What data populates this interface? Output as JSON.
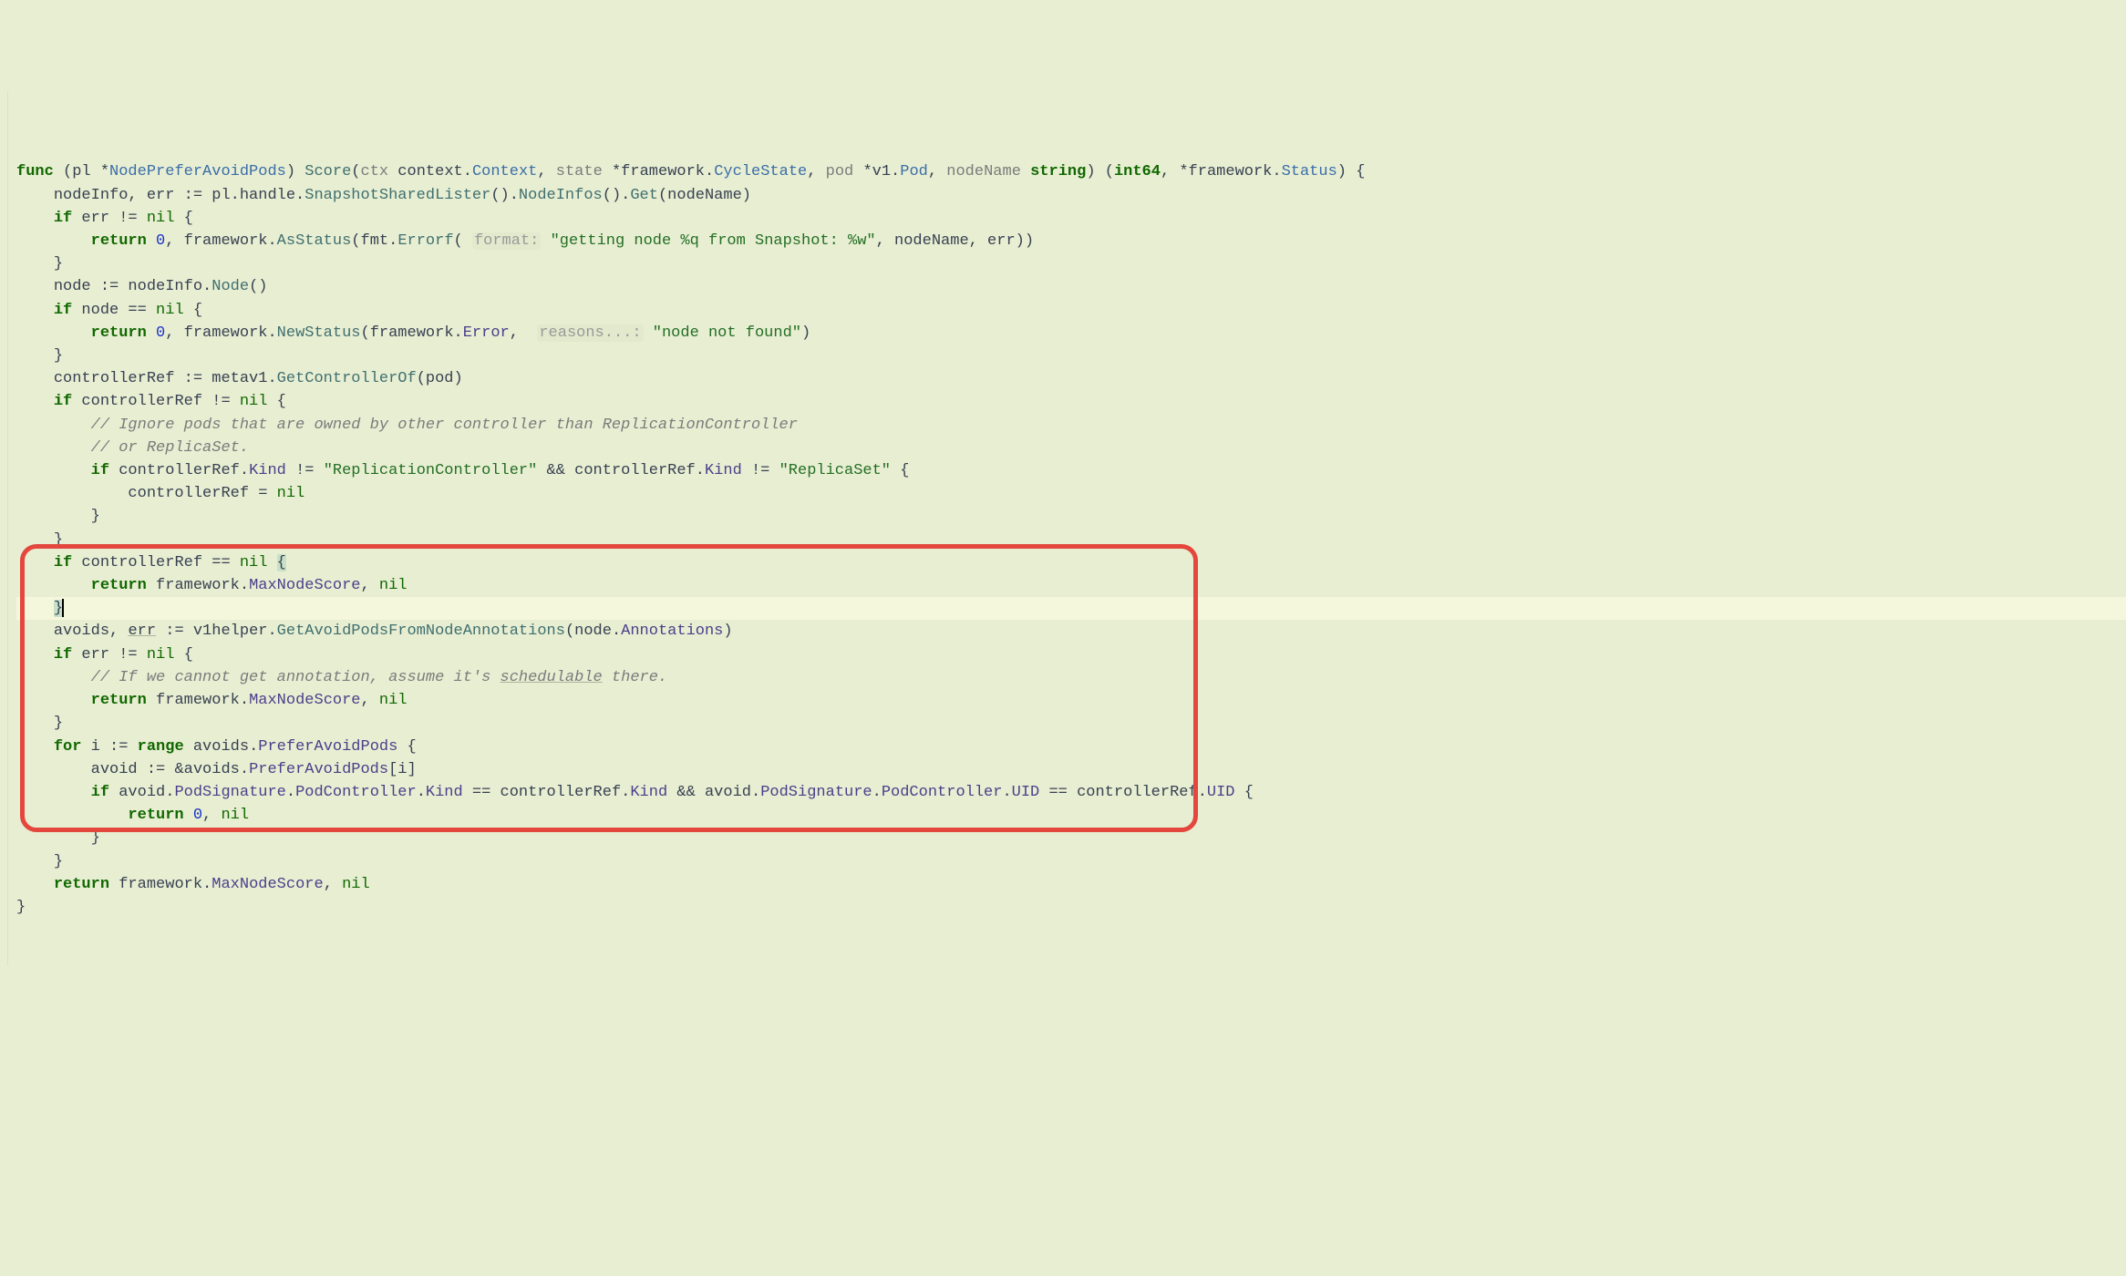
{
  "lang": "go",
  "colors": {
    "bg": "#e8eed2",
    "highlight_line": "#f5f7dc",
    "box": "#e4473d"
  },
  "lines": [
    {
      "n": 1,
      "tokens": [
        {
          "t": "func ",
          "c": "kw"
        },
        {
          "t": "(pl *",
          "c": "op"
        },
        {
          "t": "NodePreferAvoidPods",
          "c": "type"
        },
        {
          "t": ") ",
          "c": "op"
        },
        {
          "t": "Score",
          "c": "fn"
        },
        {
          "t": "(",
          "c": "op"
        },
        {
          "t": "ctx",
          "c": "param"
        },
        {
          "t": " context.",
          "c": "id"
        },
        {
          "t": "Context",
          "c": "type"
        },
        {
          "t": ", ",
          "c": "op"
        },
        {
          "t": "state",
          "c": "param"
        },
        {
          "t": " *framework.",
          "c": "id"
        },
        {
          "t": "CycleState",
          "c": "type"
        },
        {
          "t": ", ",
          "c": "op"
        },
        {
          "t": "pod",
          "c": "param"
        },
        {
          "t": " *v1.",
          "c": "id"
        },
        {
          "t": "Pod",
          "c": "type"
        },
        {
          "t": ", ",
          "c": "op"
        },
        {
          "t": "nodeName",
          "c": "param"
        },
        {
          "t": " ",
          "c": "op"
        },
        {
          "t": "string",
          "c": "kw"
        },
        {
          "t": ") (",
          "c": "op"
        },
        {
          "t": "int64",
          "c": "kw"
        },
        {
          "t": ", *framework.",
          "c": "id"
        },
        {
          "t": "Status",
          "c": "type"
        },
        {
          "t": ") {",
          "c": "op"
        }
      ]
    },
    {
      "n": 2,
      "indent": 1,
      "tokens": [
        {
          "t": "nodeInfo, err := pl.handle.",
          "c": "id"
        },
        {
          "t": "SnapshotSharedLister",
          "c": "fn"
        },
        {
          "t": "().",
          "c": "op"
        },
        {
          "t": "NodeInfos",
          "c": "fn"
        },
        {
          "t": "().",
          "c": "op"
        },
        {
          "t": "Get",
          "c": "fn"
        },
        {
          "t": "(nodeName)",
          "c": "op"
        }
      ]
    },
    {
      "n": 3,
      "indent": 1,
      "tokens": [
        {
          "t": "if ",
          "c": "kw"
        },
        {
          "t": "err != ",
          "c": "id"
        },
        {
          "t": "nil ",
          "c": "nil"
        },
        {
          "t": "{",
          "c": "op"
        }
      ]
    },
    {
      "n": 4,
      "indent": 2,
      "tokens": [
        {
          "t": "return ",
          "c": "kw"
        },
        {
          "t": "0",
          "c": "num"
        },
        {
          "t": ", framework.",
          "c": "id"
        },
        {
          "t": "AsStatus",
          "c": "fn"
        },
        {
          "t": "(fmt.",
          "c": "id"
        },
        {
          "t": "Errorf",
          "c": "fn"
        },
        {
          "t": "( ",
          "c": "op"
        },
        {
          "t": "format:",
          "c": "hint"
        },
        {
          "t": " ",
          "c": "op"
        },
        {
          "t": "\"getting node %q from Snapshot: %w\"",
          "c": "str"
        },
        {
          "t": ", nodeName, err))",
          "c": "id"
        }
      ]
    },
    {
      "n": 5,
      "indent": 1,
      "tokens": [
        {
          "t": "}",
          "c": "op"
        }
      ]
    },
    {
      "n": 6,
      "indent": 1,
      "tokens": [
        {
          "t": "node := nodeInfo.",
          "c": "id"
        },
        {
          "t": "Node",
          "c": "fn"
        },
        {
          "t": "()",
          "c": "op"
        }
      ]
    },
    {
      "n": 7,
      "indent": 1,
      "tokens": [
        {
          "t": "if ",
          "c": "kw"
        },
        {
          "t": "node == ",
          "c": "id"
        },
        {
          "t": "nil ",
          "c": "nil"
        },
        {
          "t": "{",
          "c": "op"
        }
      ]
    },
    {
      "n": 8,
      "indent": 2,
      "tokens": [
        {
          "t": "return ",
          "c": "kw"
        },
        {
          "t": "0",
          "c": "num"
        },
        {
          "t": ", framework.",
          "c": "id"
        },
        {
          "t": "NewStatus",
          "c": "fn"
        },
        {
          "t": "(framework.",
          "c": "id"
        },
        {
          "t": "Error",
          "c": "member"
        },
        {
          "t": ",  ",
          "c": "op"
        },
        {
          "t": "reasons...:",
          "c": "hint"
        },
        {
          "t": " ",
          "c": "op"
        },
        {
          "t": "\"node not found\"",
          "c": "str"
        },
        {
          "t": ")",
          "c": "op"
        }
      ]
    },
    {
      "n": 9,
      "indent": 1,
      "tokens": [
        {
          "t": "}",
          "c": "op"
        }
      ]
    },
    {
      "n": 10,
      "indent": 1,
      "tokens": [
        {
          "t": "controllerRef := metav1.",
          "c": "id"
        },
        {
          "t": "GetControllerOf",
          "c": "fn"
        },
        {
          "t": "(pod)",
          "c": "op"
        }
      ]
    },
    {
      "n": 11,
      "indent": 1,
      "tokens": [
        {
          "t": "if ",
          "c": "kw"
        },
        {
          "t": "controllerRef != ",
          "c": "id"
        },
        {
          "t": "nil ",
          "c": "nil"
        },
        {
          "t": "{",
          "c": "op"
        }
      ]
    },
    {
      "n": 12,
      "indent": 2,
      "tokens": [
        {
          "t": "// Ignore pods that are owned by other controller than ReplicationController",
          "c": "comment"
        }
      ]
    },
    {
      "n": 13,
      "indent": 2,
      "tokens": [
        {
          "t": "// or ReplicaSet.",
          "c": "comment"
        }
      ]
    },
    {
      "n": 14,
      "indent": 2,
      "tokens": [
        {
          "t": "if ",
          "c": "kw"
        },
        {
          "t": "controllerRef.",
          "c": "id"
        },
        {
          "t": "Kind",
          "c": "member"
        },
        {
          "t": " != ",
          "c": "op"
        },
        {
          "t": "\"ReplicationController\"",
          "c": "str"
        },
        {
          "t": " && controllerRef.",
          "c": "id"
        },
        {
          "t": "Kind",
          "c": "member"
        },
        {
          "t": " != ",
          "c": "op"
        },
        {
          "t": "\"ReplicaSet\"",
          "c": "str"
        },
        {
          "t": " {",
          "c": "op"
        }
      ]
    },
    {
      "n": 15,
      "indent": 3,
      "tokens": [
        {
          "t": "controllerRef = ",
          "c": "id"
        },
        {
          "t": "nil",
          "c": "nil"
        }
      ]
    },
    {
      "n": 16,
      "indent": 2,
      "tokens": [
        {
          "t": "}",
          "c": "op"
        }
      ]
    },
    {
      "n": 17,
      "indent": 1,
      "tokens": [
        {
          "t": "}",
          "c": "op"
        }
      ]
    },
    {
      "n": 18,
      "indent": 1,
      "tokens": [
        {
          "t": "if ",
          "c": "kw"
        },
        {
          "t": "controllerRef == ",
          "c": "id"
        },
        {
          "t": "nil ",
          "c": "nil"
        },
        {
          "t": "{",
          "c": "op",
          "wrap": "brace-match"
        }
      ]
    },
    {
      "n": 19,
      "indent": 2,
      "tokens": [
        {
          "t": "return ",
          "c": "kw"
        },
        {
          "t": "framework.",
          "c": "id"
        },
        {
          "t": "MaxNodeScore",
          "c": "member"
        },
        {
          "t": ", ",
          "c": "op"
        },
        {
          "t": "nil",
          "c": "nil"
        }
      ]
    },
    {
      "n": 20,
      "indent": 1,
      "hl": true,
      "caret": true,
      "tokens": [
        {
          "t": "}",
          "c": "op",
          "wrap": "brace-match"
        }
      ]
    },
    {
      "n": 21,
      "indent": 1,
      "tokens": [
        {
          "t": "avoids, ",
          "c": "id"
        },
        {
          "t": "err",
          "c": "id underline"
        },
        {
          "t": " := v1helper.",
          "c": "id"
        },
        {
          "t": "GetAvoidPodsFromNodeAnnotations",
          "c": "fn"
        },
        {
          "t": "(node.",
          "c": "id"
        },
        {
          "t": "Annotations",
          "c": "member"
        },
        {
          "t": ")",
          "c": "op"
        }
      ]
    },
    {
      "n": 22,
      "indent": 1,
      "tokens": [
        {
          "t": "if ",
          "c": "kw"
        },
        {
          "t": "err != ",
          "c": "id"
        },
        {
          "t": "nil ",
          "c": "nil"
        },
        {
          "t": "{",
          "c": "op"
        }
      ]
    },
    {
      "n": 23,
      "indent": 2,
      "tokens": [
        {
          "t": "// If we cannot get annotation, assume it's ",
          "c": "comment"
        },
        {
          "t": "schedulable",
          "c": "comment underline"
        },
        {
          "t": " there.",
          "c": "comment"
        }
      ]
    },
    {
      "n": 24,
      "indent": 2,
      "tokens": [
        {
          "t": "return ",
          "c": "kw"
        },
        {
          "t": "framework.",
          "c": "id"
        },
        {
          "t": "MaxNodeScore",
          "c": "member"
        },
        {
          "t": ", ",
          "c": "op"
        },
        {
          "t": "nil",
          "c": "nil"
        }
      ]
    },
    {
      "n": 25,
      "indent": 1,
      "tokens": [
        {
          "t": "}",
          "c": "op"
        }
      ]
    },
    {
      "n": 26,
      "indent": 1,
      "tokens": [
        {
          "t": "for ",
          "c": "kw"
        },
        {
          "t": "i := ",
          "c": "id"
        },
        {
          "t": "range ",
          "c": "kw"
        },
        {
          "t": "avoids.",
          "c": "id"
        },
        {
          "t": "PreferAvoidPods",
          "c": "member"
        },
        {
          "t": " {",
          "c": "op"
        }
      ]
    },
    {
      "n": 27,
      "indent": 2,
      "tokens": [
        {
          "t": "avoid := &avoids.",
          "c": "id"
        },
        {
          "t": "PreferAvoidPods",
          "c": "member"
        },
        {
          "t": "[i]",
          "c": "op"
        }
      ]
    },
    {
      "n": 28,
      "indent": 2,
      "tokens": [
        {
          "t": "if ",
          "c": "kw"
        },
        {
          "t": "avoid.",
          "c": "id"
        },
        {
          "t": "PodSignature",
          "c": "member"
        },
        {
          "t": ".",
          "c": "op"
        },
        {
          "t": "PodController",
          "c": "member"
        },
        {
          "t": ".",
          "c": "op"
        },
        {
          "t": "Kind",
          "c": "member"
        },
        {
          "t": " == controllerRef.",
          "c": "id"
        },
        {
          "t": "Kind",
          "c": "member"
        },
        {
          "t": " && avoid.",
          "c": "id"
        },
        {
          "t": "PodSignature",
          "c": "member"
        },
        {
          "t": ".",
          "c": "op"
        },
        {
          "t": "PodController",
          "c": "member"
        },
        {
          "t": ".",
          "c": "op"
        },
        {
          "t": "UID",
          "c": "member"
        },
        {
          "t": " == controllerRef.",
          "c": "id"
        },
        {
          "t": "UID",
          "c": "member"
        },
        {
          "t": " {",
          "c": "op"
        }
      ]
    },
    {
      "n": 29,
      "indent": 3,
      "tokens": [
        {
          "t": "return ",
          "c": "kw"
        },
        {
          "t": "0",
          "c": "num"
        },
        {
          "t": ", ",
          "c": "op"
        },
        {
          "t": "nil",
          "c": "nil"
        }
      ]
    },
    {
      "n": 30,
      "indent": 2,
      "tokens": [
        {
          "t": "}",
          "c": "op"
        }
      ]
    },
    {
      "n": 31,
      "indent": 1,
      "tokens": [
        {
          "t": "}",
          "c": "op"
        }
      ]
    },
    {
      "n": 32,
      "indent": 1,
      "tokens": [
        {
          "t": "return ",
          "c": "kw"
        },
        {
          "t": "framework.",
          "c": "id"
        },
        {
          "t": "MaxNodeScore",
          "c": "member"
        },
        {
          "t": ", ",
          "c": "op"
        },
        {
          "t": "nil",
          "c": "nil"
        }
      ]
    },
    {
      "n": 33,
      "indent": 0,
      "tokens": [
        {
          "t": "}",
          "c": "op"
        }
      ]
    }
  ],
  "highlight_box": {
    "from_line": 21,
    "to_line": 32
  }
}
